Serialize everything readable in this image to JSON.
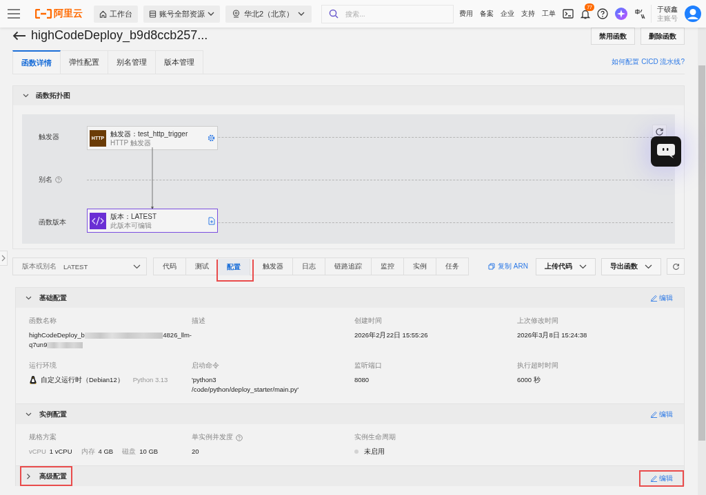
{
  "topbar": {
    "logo": "阿里云",
    "workbench": "工作台",
    "resources": "账号全部资源",
    "region": "华北2（北京）",
    "search_placeholder": "搜索...",
    "links": [
      "费用",
      "备案",
      "企业",
      "支持",
      "工单"
    ],
    "notification_count": "77",
    "user_name": "于硕鑫",
    "account_type": "主账号"
  },
  "header": {
    "title": "highCodeDeploy_b9d8ccb257...",
    "buttons": [
      "禁用函数",
      "删除函数"
    ]
  },
  "tabs": [
    {
      "label": "函数详情",
      "selected": true
    },
    {
      "label": "弹性配置",
      "selected": false
    },
    {
      "label": "别名管理",
      "selected": false
    },
    {
      "label": "版本管理",
      "selected": false
    }
  ],
  "help_link": "如何配置 CICD 流水线?",
  "topology": {
    "title": "函数拓扑图",
    "expanded": true,
    "rows": [
      {
        "label": "触发器",
        "help": false
      },
      {
        "label": "别名",
        "help": true
      },
      {
        "label": "函数版本",
        "help": false
      }
    ],
    "trigger_node": {
      "badge": "HTTP",
      "title": "触发器：test_http_trigger",
      "subtitle": "HTTP 触发器"
    },
    "version_node": {
      "title": "版本：LATEST",
      "subtitle": "此版本可编辑"
    }
  },
  "toolbar": {
    "version_select": {
      "label": "版本或别名",
      "value": "LATEST"
    },
    "subtabs": [
      {
        "label": "代码",
        "selected": false,
        "highlighted": false
      },
      {
        "label": "测试",
        "selected": false,
        "highlighted": false
      },
      {
        "label": "配置",
        "selected": true,
        "highlighted": true
      },
      {
        "label": "触发器",
        "selected": false,
        "highlighted": false
      },
      {
        "label": "日志",
        "selected": false,
        "highlighted": false
      },
      {
        "label": "链路追踪",
        "selected": false,
        "highlighted": false
      },
      {
        "label": "监控",
        "selected": false,
        "highlighted": false
      },
      {
        "label": "实例",
        "selected": false,
        "highlighted": false
      },
      {
        "label": "任务",
        "selected": false,
        "highlighted": false
      }
    ],
    "copy_arn": "复制 ARN",
    "buttons": [
      "上传代码",
      "导出函数"
    ]
  },
  "sections": [
    {
      "title": "基础配置",
      "expanded": true,
      "highlighted": false,
      "edit": "编辑",
      "edit_highlighted": false,
      "fields": [
        {
          "kind": "redacted",
          "label": "函数名称",
          "value_start": "highCodeDeploy_b",
          "value_end": "4826_llm-",
          "value_line2": "q7un9"
        },
        {
          "kind": "text",
          "label": "描述"
        },
        {
          "kind": "text",
          "label": "创建时间",
          "value": "2026年2月22日 15:55:26"
        },
        {
          "kind": "text",
          "label": "上次修改时间",
          "value": "2026年3月8日 15:24:38"
        },
        {
          "kind": "runtime",
          "label": "运行环境",
          "value": "自定义运行时（Debian12）",
          "extra": "Python 3.13"
        },
        {
          "kind": "text",
          "label": "启动命令",
          "value": "'python3 /code/python/deploy_starter/main.py'"
        },
        {
          "kind": "text",
          "label": "监听端口",
          "value": "8080"
        },
        {
          "kind": "text",
          "label": "执行超时时间",
          "value": "6000 秒"
        }
      ]
    },
    {
      "title": "实例配置",
      "expanded": true,
      "highlighted": false,
      "edit": "编辑",
      "edit_highlighted": false,
      "fields": [
        {
          "kind": "spec",
          "label": "规格方案",
          "parts": [
            {
              "label": "vCPU",
              "value": "1 vCPU"
            },
            {
              "label": "内存",
              "value": "4 GB"
            },
            {
              "label": "磁盘",
              "value": "10 GB"
            }
          ]
        },
        {
          "kind": "text",
          "label": "单实例并发度",
          "help": true,
          "value": "20"
        },
        {
          "kind": "status",
          "label": "实例生命周期",
          "value": "未启用",
          "active": false
        }
      ]
    },
    {
      "title": "高级配置",
      "expanded": false,
      "highlighted": true,
      "edit": "编辑",
      "edit_highlighted": true
    }
  ]
}
